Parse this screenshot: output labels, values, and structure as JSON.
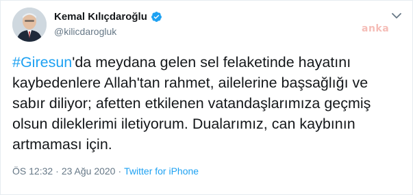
{
  "user": {
    "display_name": "Kemal Kılıçdaroğlu",
    "handle": "@kilicdarogluk",
    "verified_icon": "verified-badge-icon"
  },
  "watermark": "anka",
  "tweet": {
    "hashtag": "#Giresun",
    "body_text": "'da meydana gelen sel felaketinde hayatını kaybedenlere Allah'tan rahmet, ailelerine başsağlığı ve sabır diliyor; afetten etkilenen vatandaşlarımıza geçmiş olsun dileklerimi iletiyorum. Dualarımız, can kaybının artmaması için."
  },
  "meta": {
    "time": "ÖS 12:32",
    "separator": "·",
    "date": "23 Ağu 2020",
    "source": "Twitter for iPhone"
  },
  "colors": {
    "link": "#1da1f2",
    "secondary_text": "#657786",
    "primary_text": "#14171a"
  }
}
